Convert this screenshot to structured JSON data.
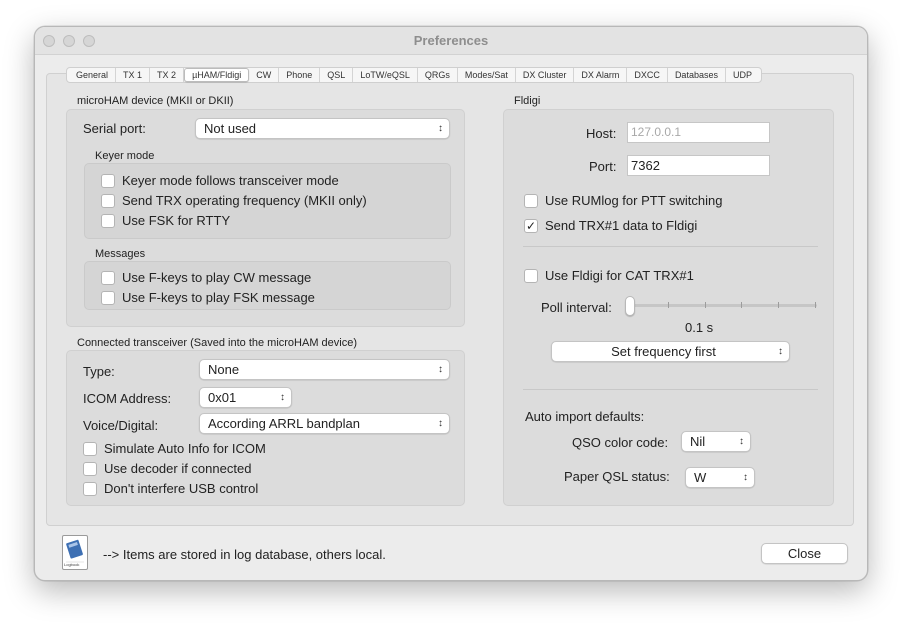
{
  "window": {
    "title": "Preferences"
  },
  "tabs": [
    {
      "label": "General"
    },
    {
      "label": "TX 1"
    },
    {
      "label": "TX 2"
    },
    {
      "label": "µHAM/Fldigi",
      "active": true
    },
    {
      "label": "CW"
    },
    {
      "label": "Phone"
    },
    {
      "label": "QSL"
    },
    {
      "label": "LoTW/eQSL"
    },
    {
      "label": "QRGs"
    },
    {
      "label": "Modes/Sat"
    },
    {
      "label": "DX Cluster"
    },
    {
      "label": "DX Alarm"
    },
    {
      "label": "DXCC"
    },
    {
      "label": "Databases"
    },
    {
      "label": "UDP"
    }
  ],
  "microham": {
    "section_label": "microHAM device (MKII or DKII)",
    "serial_port_label": "Serial port:",
    "serial_port_value": "Not used",
    "keyer_mode_label": "Keyer mode",
    "keyer_options": [
      {
        "label": "Keyer mode follows transceiver mode",
        "checked": false
      },
      {
        "label": "Send TRX operating frequency (MKII only)",
        "checked": false
      },
      {
        "label": "Use FSK for RTTY",
        "checked": false
      }
    ],
    "messages_label": "Messages",
    "message_options": [
      {
        "label": "Use F-keys to play CW message",
        "checked": false
      },
      {
        "label": "Use F-keys to play FSK message",
        "checked": false
      }
    ]
  },
  "transceiver": {
    "section_label": "Connected transceiver (Saved into the microHAM device)",
    "type_label": "Type:",
    "type_value": "None",
    "icom_address_label": "ICOM Address:",
    "icom_address_value": "0x01",
    "voice_digital_label": "Voice/Digital:",
    "voice_digital_value": "According ARRL bandplan",
    "options": [
      {
        "label": "Simulate Auto Info for ICOM",
        "checked": false
      },
      {
        "label": "Use decoder if connected",
        "checked": false
      },
      {
        "label": "Don't interfere USB control",
        "checked": false
      }
    ]
  },
  "fldigi": {
    "section_label": "Fldigi",
    "host_label": "Host:",
    "host_placeholder": "127.0.0.1",
    "port_label": "Port:",
    "port_value": "7362",
    "use_rumlog_ptt": {
      "label": "Use RUMlog for PTT switching",
      "checked": false
    },
    "send_trx_data": {
      "label": "Send TRX#1 data to Fldigi",
      "checked": true
    },
    "use_fldigi_cat": {
      "label": "Use Fldigi for CAT TRX#1",
      "checked": false
    },
    "poll_interval_label": "Poll interval:",
    "poll_interval_value": "0.1 s",
    "poll_interval_position": 0,
    "frequency_mode_value": "Set frequency first",
    "auto_import_label": "Auto import defaults:",
    "qso_color_label": "QSO color code:",
    "qso_color_value": "Nil",
    "paper_qsl_label": "Paper QSL status:",
    "paper_qsl_value": "W"
  },
  "footer": {
    "note": "--> Items are stored in log database, others local.",
    "icon_text": "Logbook",
    "close_label": "Close"
  },
  "icons": {
    "chevron": "↕",
    "check": "✓"
  }
}
